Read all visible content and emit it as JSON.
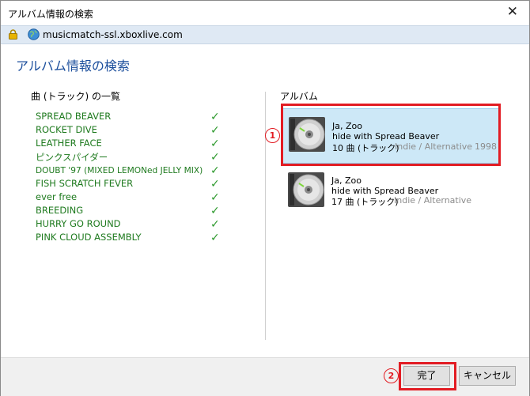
{
  "window": {
    "title": "アルバム情報の検索",
    "close_glyph": "✕"
  },
  "urlbar": {
    "url": "musicmatch-ssl.xboxlive.com"
  },
  "heading": "アルバム情報の検索",
  "tracks_label": "曲 (トラック) の一覧",
  "tracks": [
    "SPREAD BEAVER",
    "ROCKET DIVE",
    "LEATHER FACE",
    "ピンクスパイダー",
    "DOUBT '97 (MIXED LEMONed JELLY MIX)",
    "FISH SCRATCH FEVER",
    "ever free",
    "BREEDING",
    "HURRY GO ROUND",
    "PINK CLOUD ASSEMBLY"
  ],
  "check_glyph": "✓",
  "albums_label": "アルバム",
  "albums": [
    {
      "artist": "Ja, Zoo",
      "album_artist": "hide with Spread Beaver",
      "count": "10 曲 (トラック)",
      "genre": "Indie / Alternative",
      "year": "1998",
      "selected": true
    },
    {
      "artist": "Ja, Zoo",
      "album_artist": "hide with Spread Beaver",
      "count": "17 曲 (トラック)",
      "genre": "Indie / Alternative",
      "year": "",
      "selected": false
    }
  ],
  "annotations": {
    "one": "1",
    "two": "2"
  },
  "buttons": {
    "done": "完了",
    "cancel": "キャンセル"
  },
  "colors": {
    "accent_red": "#e21c23",
    "track_green": "#1e7a1e",
    "heading_blue": "#1b4e9c",
    "selection": "#cde8f7"
  }
}
